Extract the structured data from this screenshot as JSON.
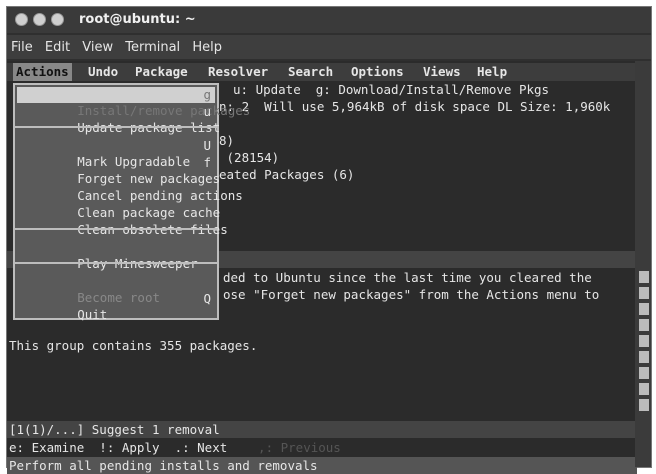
{
  "window": {
    "title": "root@ubuntu: ~"
  },
  "gnome_menu": [
    "File",
    "Edit",
    "View",
    "Terminal",
    "Help"
  ],
  "aptitude_menu": [
    "Actions",
    "Undo",
    "Package",
    "Resolver",
    "Search",
    "Options",
    "Views",
    "Help"
  ],
  "header": {
    "line1": "u: Update  g: Download/Install/Remove Pkgs",
    "line2": "n: 2  Will use 5,964kB of disk space DL Size: 1,960k"
  },
  "package_tree": {
    "row1": "8)",
    "row2": " (28154)",
    "row3": "eated Packages (6)"
  },
  "dropdown": {
    "items": [
      {
        "label": "Install/remove packages",
        "key": "g"
      },
      {
        "label": "Update package list",
        "key": "u"
      },
      {
        "label": "Mark Upgradable",
        "key": "U"
      },
      {
        "label": "Forget new packages",
        "key": "f"
      },
      {
        "label": "Cancel pending actions",
        "key": ""
      },
      {
        "label": "Clean package cache",
        "key": ""
      },
      {
        "label": "Clean obsolete files",
        "key": ""
      },
      {
        "label": "Play Minesweeper",
        "key": ""
      },
      {
        "label": "Become root",
        "key": ""
      },
      {
        "label": "Quit",
        "key": "Q"
      }
    ]
  },
  "description": {
    "line1": "ded to Ubuntu since the last time you cleared the",
    "line2": "ose \"Forget new packages\" from the Actions menu to",
    "line3": "This group contains 355 packages."
  },
  "status": {
    "suggest": "[1(1)/...] Suggest 1 removal",
    "keys": "e: Examine  !: Apply  .: Next",
    "prev": "  ,: Previous",
    "bottom": "Perform all pending installs and removals"
  }
}
